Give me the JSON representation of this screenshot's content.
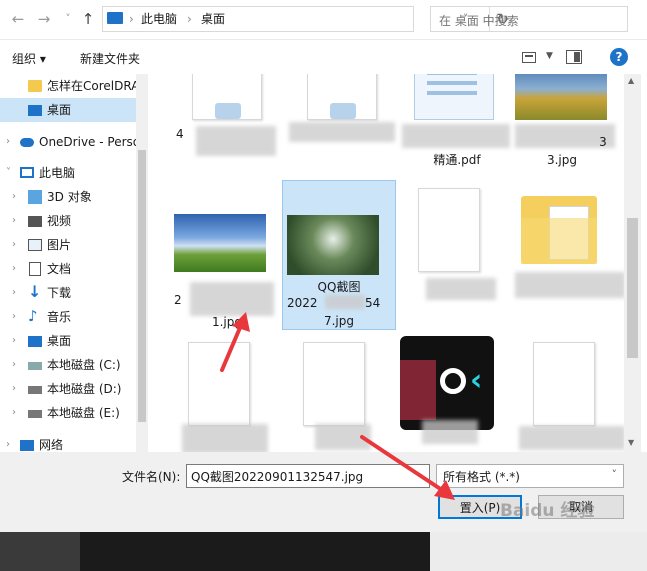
{
  "nav": {
    "back": "←",
    "forward": "→",
    "dropdown": "˅",
    "up": "↑",
    "sep": "›",
    "breadcrumb": [
      "此电脑",
      "桌面"
    ],
    "refresh": "↻",
    "search_placeholder": "在 桌面 中搜索"
  },
  "toolbar": {
    "organize": "组织 ▾",
    "new_folder": "新建文件夹",
    "help": "?"
  },
  "sidebar": {
    "items": [
      {
        "label": "怎样在CorelDRA",
        "icon": "folder-icon"
      },
      {
        "label": "桌面",
        "icon": "desktop-icon"
      },
      {
        "label": "OneDrive - Perso",
        "icon": "cloud-icon"
      },
      {
        "label": "此电脑",
        "icon": "computer-icon"
      },
      {
        "label": "3D 对象",
        "icon": "cube-icon"
      },
      {
        "label": "视频",
        "icon": "video-icon"
      },
      {
        "label": "图片",
        "icon": "picture-icon"
      },
      {
        "label": "文档",
        "icon": "document-icon"
      },
      {
        "label": "下载",
        "icon": "download-icon"
      },
      {
        "label": "音乐",
        "icon": "music-icon"
      },
      {
        "label": "桌面",
        "icon": "desktop-icon"
      },
      {
        "label": "本地磁盘 (C:)",
        "icon": "drive-icon"
      },
      {
        "label": "本地磁盘 (D:)",
        "icon": "drive-icon"
      },
      {
        "label": "本地磁盘 (E:)",
        "icon": "drive-icon"
      },
      {
        "label": "网络",
        "icon": "network-icon"
      }
    ]
  },
  "files": {
    "row1_names": [
      "4",
      "",
      "精通.pdf",
      "3.jpg"
    ],
    "row1_extra": "3",
    "row2": [
      {
        "line1": "2",
        "line2": "1.jpg"
      },
      {
        "line1": "QQ截图",
        "line1b": "2022",
        "line1c": "54",
        "line2": "7.jpg"
      },
      {
        "line1": "",
        "line2": ""
      },
      {
        "line1": "",
        "line2": ""
      }
    ]
  },
  "bottom": {
    "filename_label": "文件名(N):",
    "filename_value": "QQ截图20220901132547.jpg",
    "filetype": "所有格式 (*.*)",
    "open_button": "置入(P)",
    "cancel_button": "取消"
  },
  "watermark": "Baidu 经验",
  "colors": {
    "selection": "#cce4f7",
    "accent": "#0078d7",
    "arrow": "#e8383d"
  }
}
